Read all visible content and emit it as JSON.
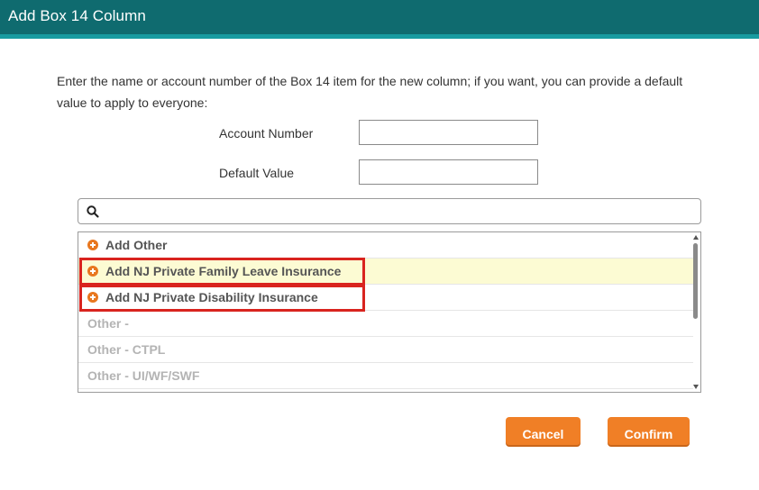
{
  "dialog": {
    "title": "Add Box 14 Column",
    "instructions": "Enter the name or account number of the Box 14 item for the new column; if you want, you can provide a default value to apply to everyone:"
  },
  "form": {
    "account_number_label": "Account Number",
    "account_number_value": "",
    "default_value_label": "Default Value",
    "default_value_value": ""
  },
  "search": {
    "icon": "search-icon",
    "value": "",
    "placeholder": ""
  },
  "list": {
    "items": [
      {
        "label": "Add Other",
        "kind": "add",
        "icon": "plus-circle-icon",
        "highlighted": false,
        "outlined": false
      },
      {
        "label": "Add NJ Private Family Leave Insurance",
        "kind": "add",
        "icon": "plus-circle-icon",
        "highlighted": true,
        "outlined": true
      },
      {
        "label": "Add NJ Private Disability Insurance",
        "kind": "add",
        "icon": "plus-circle-icon",
        "highlighted": false,
        "outlined": true
      },
      {
        "label": "Other -",
        "kind": "other",
        "highlighted": false,
        "outlined": false
      },
      {
        "label": "Other - CTPL",
        "kind": "other",
        "highlighted": false,
        "outlined": false
      },
      {
        "label": "Other - UI/WF/SWF",
        "kind": "other",
        "highlighted": false,
        "outlined": false
      }
    ]
  },
  "buttons": {
    "cancel_label": "Cancel",
    "confirm_label": "Confirm"
  },
  "colors": {
    "titlebar": "#0f6b6f",
    "titlebar_accent": "#189ba0",
    "button": "#f07f26",
    "highlight_row": "#fcfbd3",
    "annotation_red": "#d9241f",
    "plus_icon": "#e8771f"
  }
}
